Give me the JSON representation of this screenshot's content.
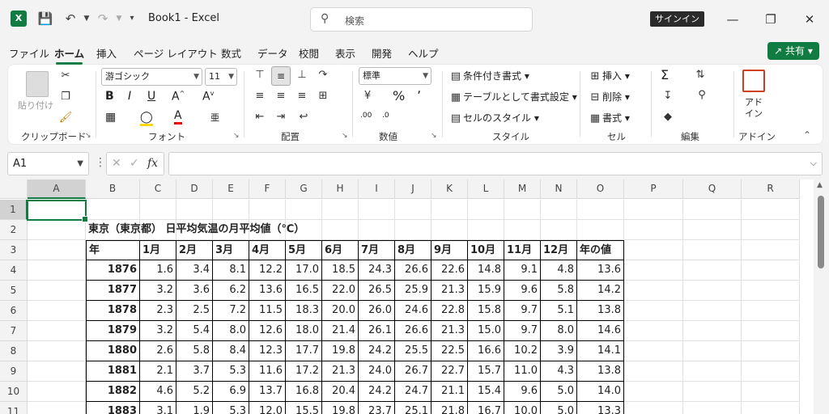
{
  "titlebar": {
    "app_icon": "X",
    "title": "Book1  -  Excel",
    "search_placeholder": "検索",
    "signin_label": "サインイン",
    "icons": [
      "save-icon",
      "undo-icon",
      "redo-icon",
      "customize-icon"
    ]
  },
  "menu": {
    "tabs": [
      "ファイル",
      "ホーム",
      "挿入",
      "ページ レイアウト",
      "数式",
      "データ",
      "校閲",
      "表示",
      "開発",
      "ヘルプ"
    ],
    "active": "ホーム",
    "share_label": "共有"
  },
  "ribbon": {
    "clipboard": {
      "paste_label": "貼り付け",
      "group_label": "クリップボード"
    },
    "font": {
      "font_name": "游ゴシック",
      "font_size": "11",
      "group_label": "フォント"
    },
    "alignment": {
      "group_label": "配置"
    },
    "number": {
      "format": "標準",
      "group_label": "数値"
    },
    "styles": {
      "conditional": "条件付き書式",
      "table": "テーブルとして書式設定",
      "cell_style": "セルのスタイル",
      "group_label": "スタイル"
    },
    "cells": {
      "insert": "挿入",
      "delete": "削除",
      "format": "書式",
      "group_label": "セル"
    },
    "editing": {
      "group_label": "編集"
    },
    "addins": {
      "label": "アド\nイン",
      "group_label": "アドイン"
    }
  },
  "formula_bar": {
    "name_box": "A1",
    "fx": "fx",
    "content": ""
  },
  "sheet": {
    "columns": [
      "A",
      "B",
      "C",
      "D",
      "E",
      "F",
      "G",
      "H",
      "I",
      "J",
      "K",
      "L",
      "M",
      "N",
      "O",
      "P",
      "Q",
      "R"
    ],
    "rows": [
      "1",
      "2",
      "3",
      "4",
      "5",
      "6",
      "7",
      "8",
      "9",
      "10",
      "11"
    ],
    "title": "東京（東京都） 日平均気温の月平均値（℃）",
    "header": [
      "年",
      "1月",
      "2月",
      "3月",
      "4月",
      "5月",
      "6月",
      "7月",
      "8月",
      "9月",
      "10月",
      "11月",
      "12月",
      "年の値"
    ],
    "data": [
      [
        "1876",
        "1.6",
        "3.4",
        "8.1",
        "12.2",
        "17.0",
        "18.5",
        "24.3",
        "26.6",
        "22.6",
        "14.8",
        "9.1",
        "4.8",
        "13.6"
      ],
      [
        "1877",
        "3.2",
        "3.6",
        "6.2",
        "13.6",
        "16.5",
        "22.0",
        "26.5",
        "25.9",
        "21.3",
        "15.9",
        "9.6",
        "5.8",
        "14.2"
      ],
      [
        "1878",
        "2.3",
        "2.5",
        "7.2",
        "11.5",
        "18.3",
        "20.0",
        "26.0",
        "24.6",
        "22.8",
        "15.8",
        "9.7",
        "5.1",
        "13.8"
      ],
      [
        "1879",
        "3.2",
        "5.4",
        "8.0",
        "12.6",
        "18.0",
        "21.4",
        "26.1",
        "26.6",
        "21.3",
        "15.0",
        "9.7",
        "8.0",
        "14.6"
      ],
      [
        "1880",
        "2.6",
        "5.8",
        "8.4",
        "12.3",
        "17.7",
        "19.8",
        "24.2",
        "25.5",
        "22.5",
        "16.6",
        "10.2",
        "3.9",
        "14.1"
      ],
      [
        "1881",
        "2.1",
        "3.7",
        "5.3",
        "11.6",
        "17.2",
        "21.3",
        "24.0",
        "26.7",
        "22.7",
        "15.7",
        "11.0",
        "4.3",
        "13.8"
      ],
      [
        "1882",
        "4.6",
        "5.2",
        "6.9",
        "13.7",
        "16.8",
        "20.4",
        "24.2",
        "24.7",
        "21.1",
        "15.4",
        "9.6",
        "5.0",
        "14.0"
      ],
      [
        "1883",
        "3.1",
        "1.9",
        "5.3",
        "12.0",
        "15.5",
        "19.8",
        "23.7",
        "25.1",
        "21.8",
        "16.7",
        "10.0",
        "5.0",
        "13.3"
      ]
    ]
  }
}
